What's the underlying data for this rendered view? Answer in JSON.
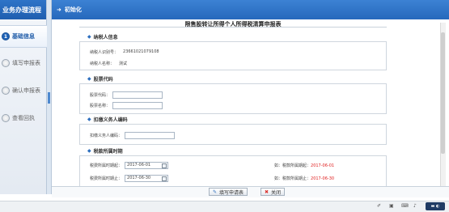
{
  "sidebar": {
    "title": "业务办理流程",
    "steps": [
      {
        "num": "1",
        "label": "基础信息",
        "active": true
      },
      {
        "num": "",
        "label": "填写申报表",
        "active": false
      },
      {
        "num": "",
        "label": "确认申报表",
        "active": false
      },
      {
        "num": "",
        "label": "查看回执",
        "active": false
      }
    ]
  },
  "header": {
    "title": "初始化"
  },
  "form": {
    "title": "限售股转让所得个人所得税清算申报表",
    "taxpayer": {
      "heading": "纳税人信息",
      "id_label": "纳税人识别号：",
      "id_value": "23661021079108",
      "name_label": "纳税人名称：",
      "name_value": "测试"
    },
    "stock": {
      "heading": "股票代码",
      "code_label": "股票代码：",
      "code_value": "",
      "name_label": "股票名称：",
      "name_value": ""
    },
    "withholding": {
      "heading": "扣缴义务人编码",
      "code_label": "扣缴义务人编码：",
      "code_value": ""
    },
    "period": {
      "heading": "税款所属时期",
      "start_label": "税费所属时期起：",
      "start_value": "2017-06-01",
      "end_label": "税费所属时期止：",
      "end_value": "2017-06-30",
      "start_note_prefix": "如：税款所属期起：",
      "start_note_date": "2017-06-01",
      "end_note_prefix": "如：税款所属期止：",
      "end_note_date": "2017-06-30"
    }
  },
  "buttons": {
    "fill": "填写申请表",
    "close": "关闭"
  },
  "taskbar": {
    "tray_icons": [
      "pen-icon",
      "network-icon",
      "keyboard-icon",
      "speaker-icon"
    ],
    "clock": "▬ ◐"
  },
  "colors": {
    "brand": "#2668bc",
    "accent_red": "#e02020"
  }
}
